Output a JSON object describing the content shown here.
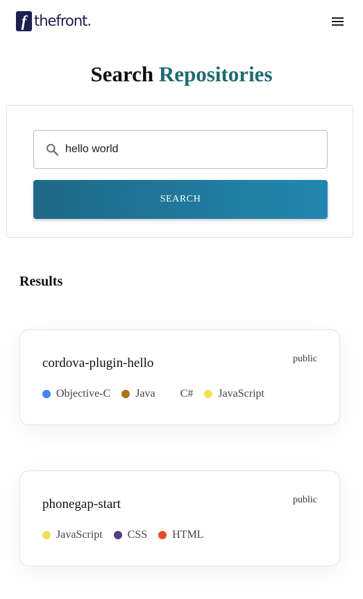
{
  "header": {
    "logo_mark": "f",
    "logo_text": "thefront."
  },
  "title": {
    "prefix": "Search",
    "accent": "Repositories"
  },
  "search": {
    "value": "hello world",
    "button_label": "Search"
  },
  "results": {
    "heading": "Results",
    "items": [
      {
        "name": "cordova-plugin-hello",
        "visibility": "public",
        "languages": [
          {
            "name": "Objective-C",
            "color": "#4285f4"
          },
          {
            "name": "Java",
            "color": "#b07219"
          },
          {
            "name": "C#",
            "color": "#ffffff"
          },
          {
            "name": "JavaScript",
            "color": "#f1e05a"
          }
        ]
      },
      {
        "name": "phonegap-start",
        "visibility": "public",
        "languages": [
          {
            "name": "JavaScript",
            "color": "#f1e05a"
          },
          {
            "name": "CSS",
            "color": "#563d7c"
          },
          {
            "name": "HTML",
            "color": "#e34c26"
          }
        ]
      }
    ]
  }
}
